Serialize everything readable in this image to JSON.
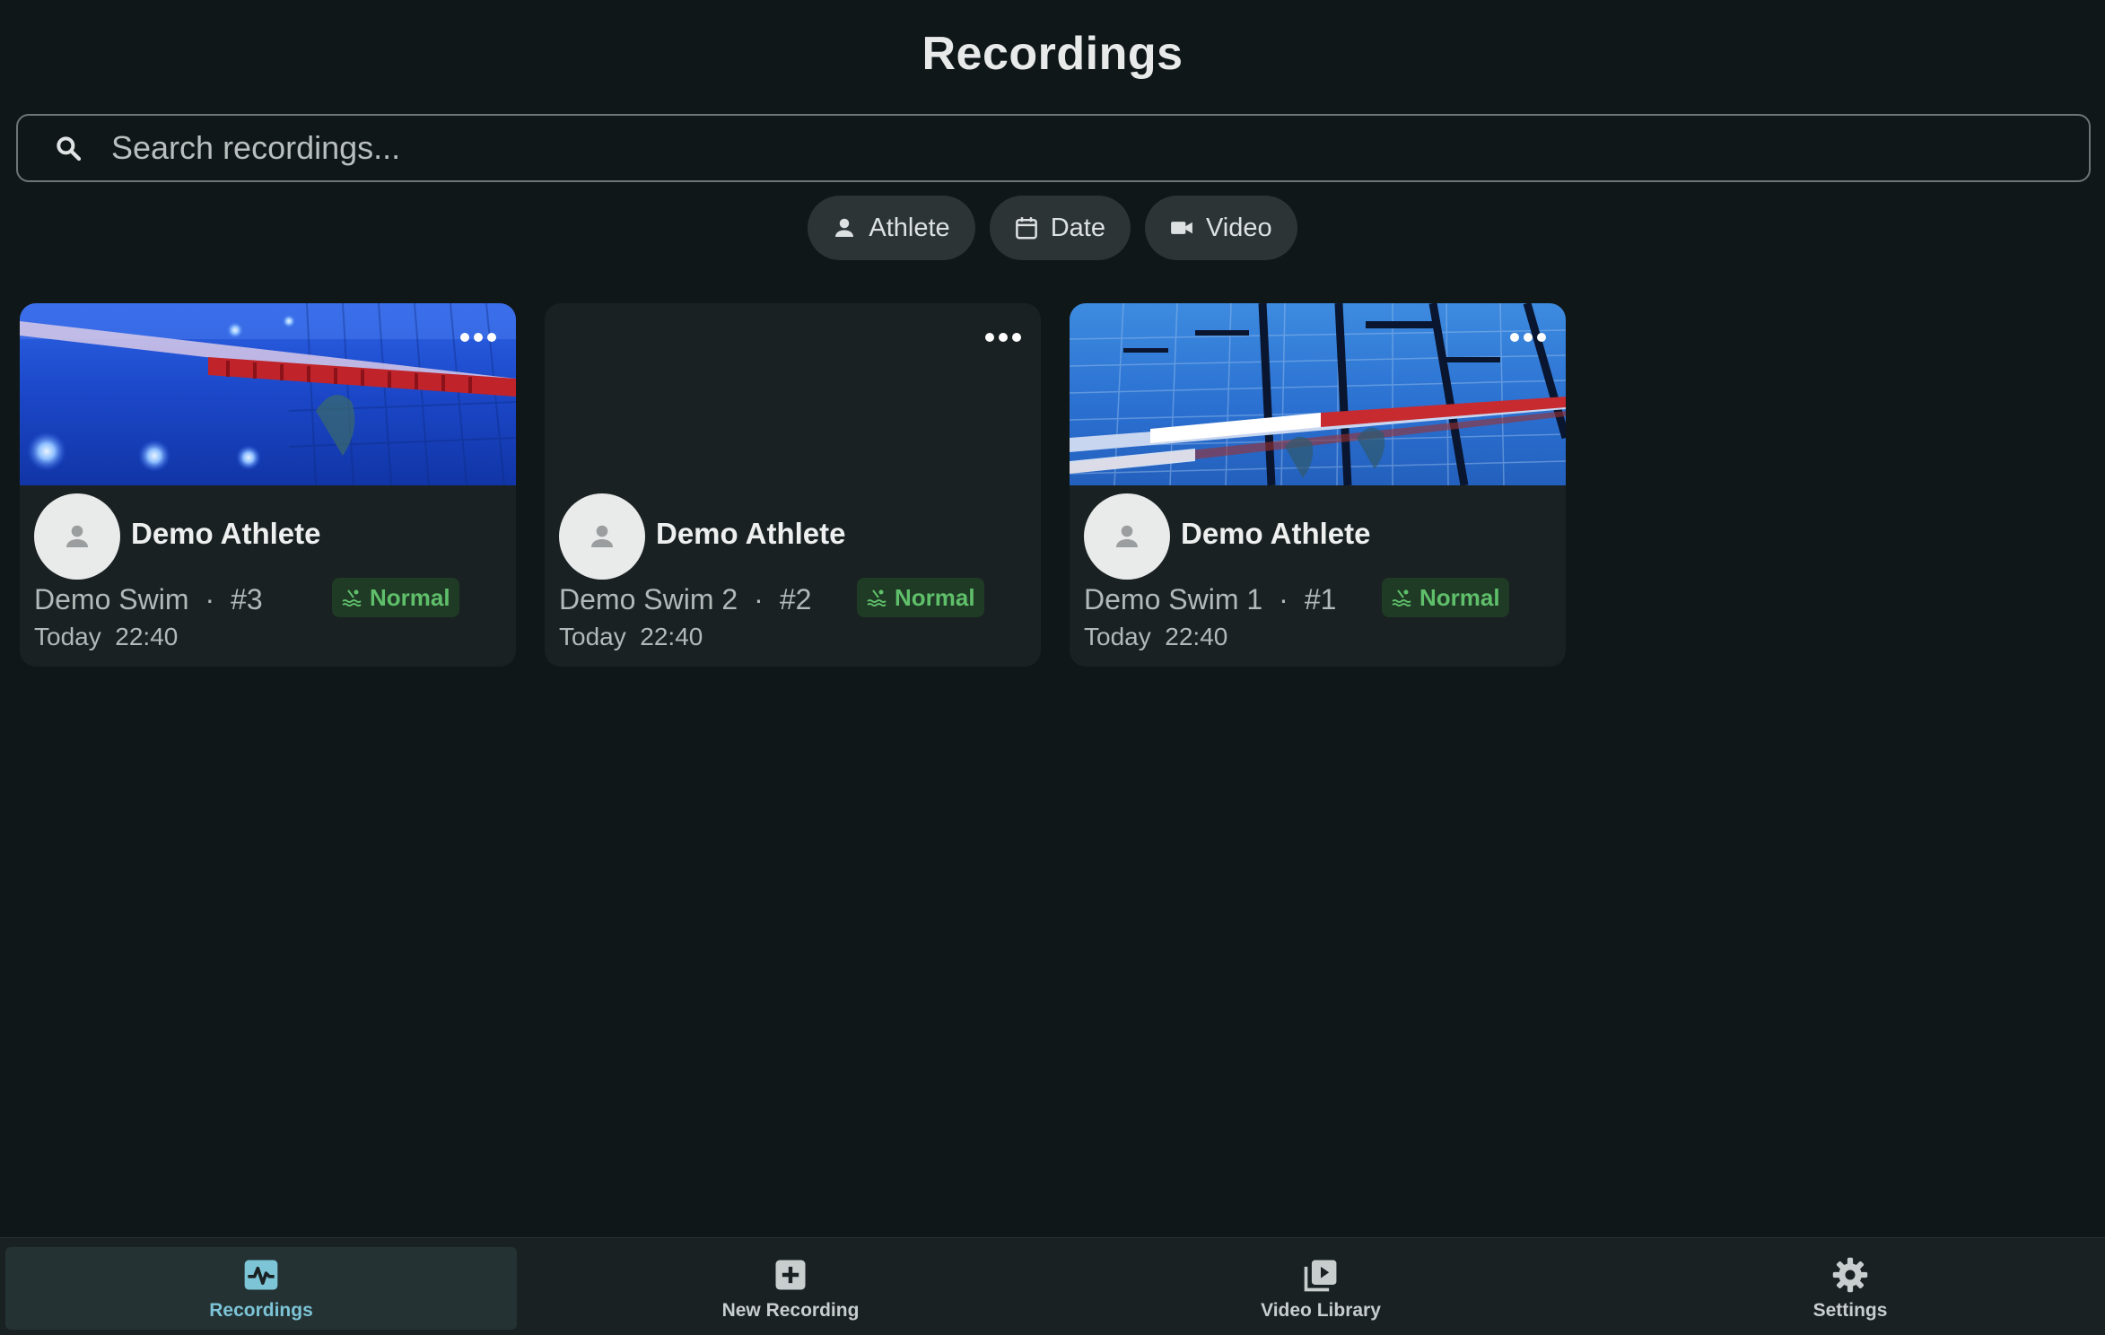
{
  "header": {
    "title": "Recordings"
  },
  "search": {
    "placeholder": "Search recordings..."
  },
  "filters": [
    {
      "label": "Athlete",
      "icon": "person-icon"
    },
    {
      "label": "Date",
      "icon": "calendar-icon"
    },
    {
      "label": "Video",
      "icon": "videocam-icon"
    }
  ],
  "recordings": [
    {
      "athlete": "Demo Athlete",
      "title": "Demo Swim",
      "number": "#3",
      "day": "Today",
      "time": "22:40",
      "status": "Normal",
      "thumbnail": "pool-lane-underwater"
    },
    {
      "athlete": "Demo Athlete",
      "title": "Demo Swim 2",
      "number": "#2",
      "day": "Today",
      "time": "22:40",
      "status": "Normal",
      "thumbnail": "none"
    },
    {
      "athlete": "Demo Athlete",
      "title": "Demo Swim 1",
      "number": "#1",
      "day": "Today",
      "time": "22:40",
      "status": "Normal",
      "thumbnail": "pool-lane-underwater"
    }
  ],
  "meta_separator": "·",
  "nav": {
    "items": [
      {
        "label": "Recordings",
        "icon": "activity-icon",
        "active": true
      },
      {
        "label": "New Recording",
        "icon": "add-box-icon",
        "active": false
      },
      {
        "label": "Video Library",
        "icon": "video-library-icon",
        "active": false
      },
      {
        "label": "Settings",
        "icon": "gear-icon",
        "active": false
      }
    ]
  },
  "colors": {
    "background": "#101718",
    "card": "#1a2122",
    "chip": "#2c3435",
    "accent": "#7cc4d6",
    "status_green": "#5fbf6a"
  }
}
